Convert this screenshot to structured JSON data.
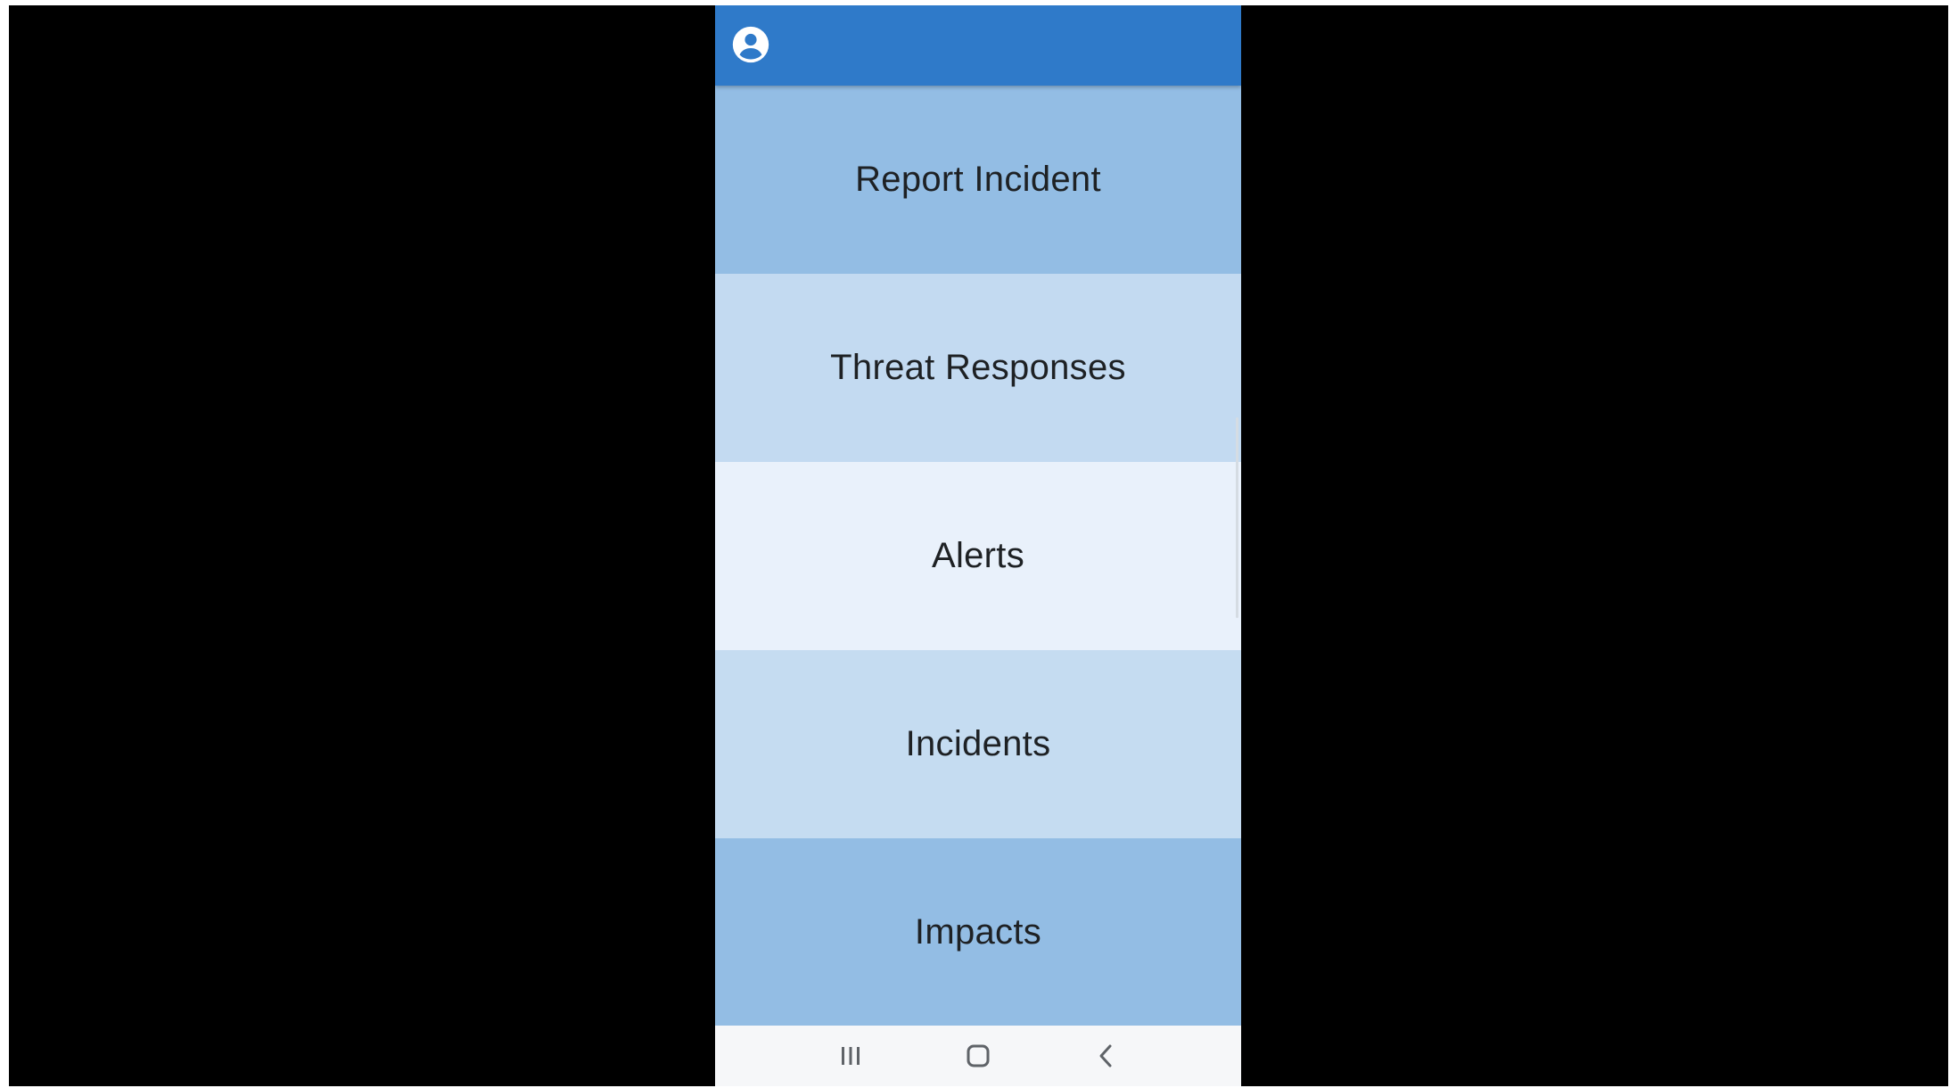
{
  "colors": {
    "app_bar": "#2f7ac9",
    "background": "#000000",
    "nav_bar": "#f6f7f9"
  },
  "app_bar": {
    "account_icon": "account-circle-icon"
  },
  "menu": {
    "items": [
      {
        "label": "Report Incident",
        "color": "#93bde4"
      },
      {
        "label": "Threat Responses",
        "color": "#c3daf1"
      },
      {
        "label": "Alerts",
        "color": "#e9f1fb"
      },
      {
        "label": "Incidents",
        "color": "#c5dcf1"
      },
      {
        "label": "Impacts",
        "color": "#93bde4"
      }
    ]
  },
  "nav_bar": {
    "recents_icon": "recents-icon",
    "home_icon": "home-icon",
    "back_icon": "back-icon"
  }
}
